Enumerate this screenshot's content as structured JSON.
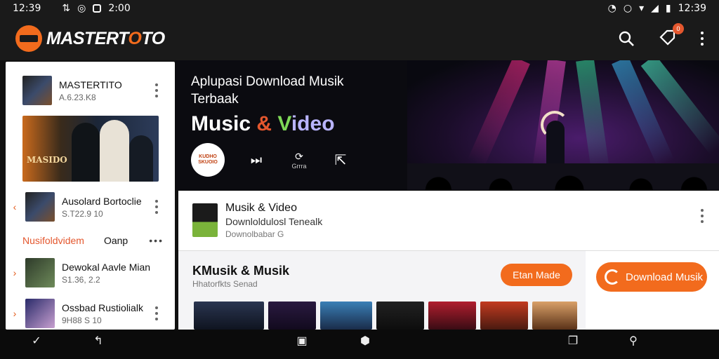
{
  "status_bar": {
    "time_left": "12:39",
    "time_mid": "2:00",
    "time_right": "12:39"
  },
  "app_bar": {
    "brand_pre": "MASTERT",
    "brand_o": "O",
    "brand_post": "TO",
    "notification_count": "0"
  },
  "sidebar": {
    "featured": {
      "title": "MASTERTITO",
      "subtitle": "A.6.23.K8"
    },
    "poster_text": "MASIDO",
    "items": [
      {
        "title": "Ausolard Bortoclie",
        "subtitle": "S.T22.9 10"
      },
      {
        "title": "Dewokal Aavle Mian",
        "subtitle": "S1.36, 2.2"
      },
      {
        "title": "Ossbad Rustiolialk",
        "subtitle": "9H88 S 10"
      }
    ],
    "tab_active": "Nusifoldvidem",
    "tab_other": "Oanp"
  },
  "hero": {
    "subtitle": "Aplupasi Download Musik Terbaak",
    "title_a": "Music ",
    "title_amp": "&",
    "title_v": " V",
    "title_rest": "ideo",
    "disc_label": "KUDHO SKUOIO",
    "repeat_label": "Grrra"
  },
  "card": {
    "title": "Musik & Video",
    "line2": "Downloldulosl Tenealk",
    "line3": "Downolbabar G"
  },
  "section": {
    "title": "KMusik & Musik",
    "subtitle": "Hhatorfkts Senad",
    "pill_label": "Etan Made"
  },
  "download_button": {
    "label": "Download Musik"
  },
  "colors": {
    "accent": "#f26b1d",
    "accent_red": "#e4572e",
    "green": "#7ed957",
    "bg_dark": "#1a1a1a"
  }
}
